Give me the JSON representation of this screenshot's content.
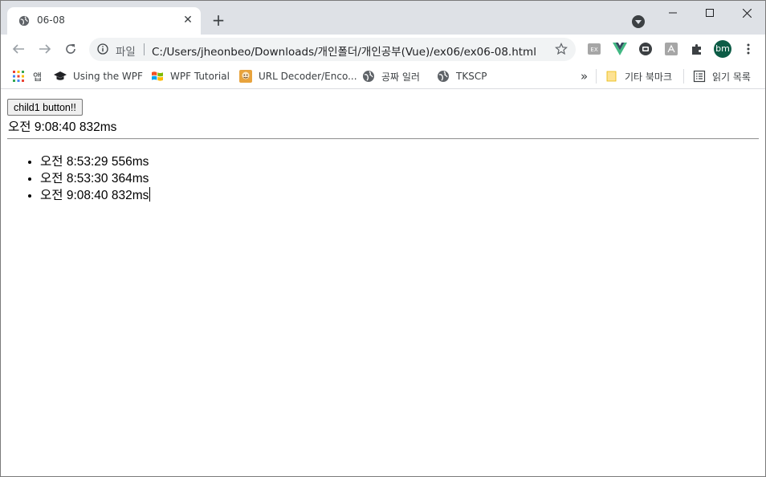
{
  "browser": {
    "tab": {
      "title": "06-08",
      "close_glyph": "✕"
    },
    "newtab_glyph": "+",
    "address": {
      "scheme_label": "파일",
      "url": "C:/Users/jheonbeo/Downloads/개인폴더/개인공부(Vue)/ex06/ex06-08.html"
    },
    "profile_initials": "bm",
    "bookmarks": {
      "apps": "앱",
      "items": [
        "Using the WPF",
        "WPF Tutorial",
        "URL Decoder/Enco...",
        "공짜 일러",
        "TKSCP"
      ],
      "overflow": "»",
      "other": "기타 북마크",
      "reading_list": "읽기 목록"
    },
    "colors": {
      "tabstrip": "#dee1e6",
      "omnibox": "#f1f3f4",
      "avatar": "#0d5c46",
      "vue": "#41b883"
    }
  },
  "page": {
    "button_label": "child1 button!!",
    "current_time": "오전 9:08:40 832ms",
    "log": [
      "오전 8:53:29 556ms",
      "오전 8:53:30 364ms",
      "오전 9:08:40 832ms"
    ]
  }
}
